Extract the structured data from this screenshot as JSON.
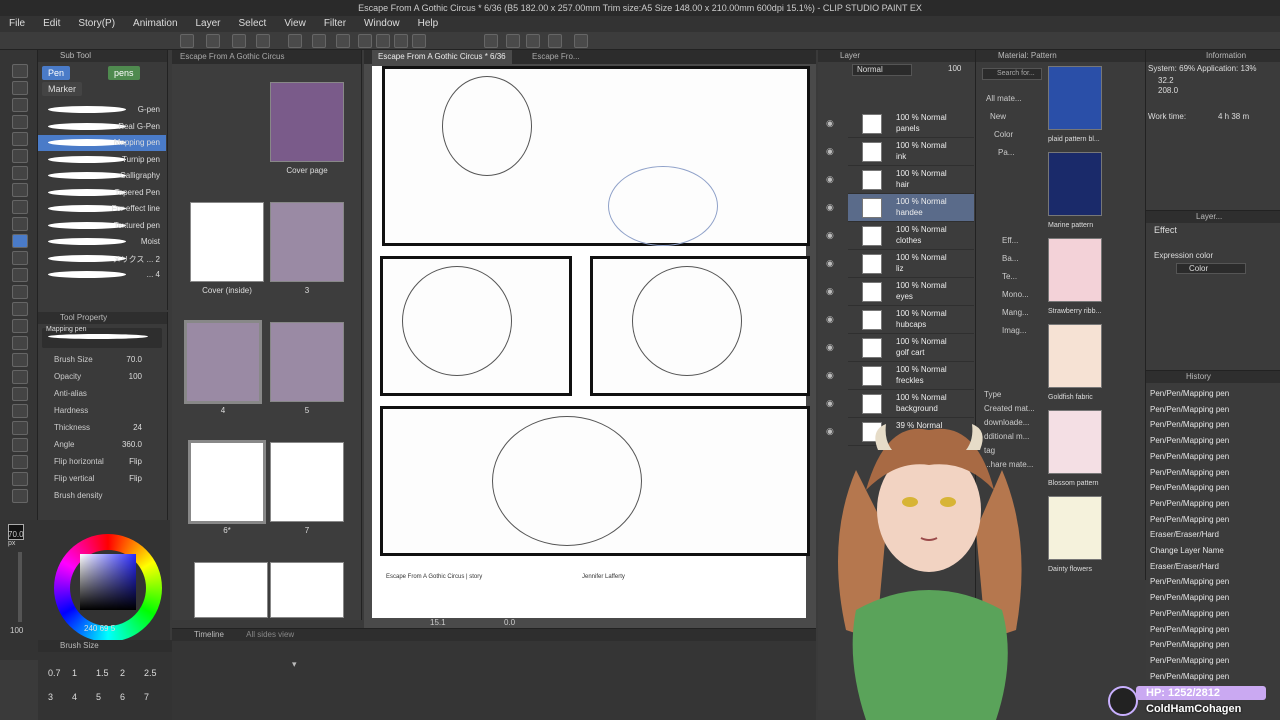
{
  "window": {
    "title": "Escape From A Gothic Circus * 6/36 (B5 182.00 x 257.00mm Trim size:A5 Size 148.00 x 210.00mm 600dpi 15.1%) - CLIP STUDIO PAINT EX"
  },
  "menu": [
    "File",
    "Edit",
    "Story(P)",
    "Animation",
    "Layer",
    "Select",
    "View",
    "Filter",
    "Window",
    "Help"
  ],
  "subtool": {
    "header": "Sub Tool",
    "tab_pen": "Pen",
    "tab_pens": "pens",
    "tab_marker": "Marker",
    "brushes": [
      "G-pen",
      "Real G-Pen",
      "Mapping pen",
      "Turnip pen",
      "Calligraphy",
      "Tapered Pen",
      "For effect line",
      "Textured pen",
      "Moist",
      "メリクス ... 2",
      "... 4"
    ]
  },
  "tool_property": {
    "header": "Tool Property",
    "preview_label": "Mapping pen",
    "rows": [
      {
        "label": "Brush Size",
        "value": "70.0"
      },
      {
        "label": "Opacity",
        "value": "100"
      },
      {
        "label": "Anti-alias",
        "value": ""
      },
      {
        "label": "Hardness",
        "value": ""
      },
      {
        "label": "Thickness",
        "value": "24"
      },
      {
        "label": "Angle",
        "value": "360.0"
      },
      {
        "label": "Flip horizontal",
        "value": "Flip"
      },
      {
        "label": "Flip vertical",
        "value": "Flip"
      },
      {
        "label": "Brush density",
        "value": ""
      }
    ]
  },
  "color": {
    "size_label": "70.0",
    "size_unit": "px",
    "opacity_label": "100",
    "values": "240  69  5"
  },
  "brush_size_panel": {
    "header": "Brush Size",
    "sizes": [
      "0.7",
      "1",
      "1.5",
      "2",
      "2.5",
      "3",
      "4",
      "5",
      "6",
      "7"
    ]
  },
  "pages": {
    "tab": "Escape From A Gothic Circus",
    "items": [
      {
        "label": "Cover page"
      },
      {
        "label": "Cover (inside)"
      },
      {
        "label": "3"
      },
      {
        "label": "4"
      },
      {
        "label": "5"
      },
      {
        "label": "6*"
      },
      {
        "label": "7"
      }
    ]
  },
  "canvas": {
    "tab1": "Escape From A Gothic Circus * 6/36",
    "tab2": "Escape Fro...",
    "footer_left": "Escape From A Gothic Circus  | story",
    "footer_right": "Jennifer Lafferty",
    "zoom": "15.1",
    "angle": "0.0"
  },
  "layers": {
    "header": "Layer",
    "blend": "Normal",
    "opacity": "100",
    "items": [
      {
        "pct": "100 % Normal",
        "name": "panels"
      },
      {
        "pct": "100 % Normal",
        "name": "ink"
      },
      {
        "pct": "100 % Normal",
        "name": "hair"
      },
      {
        "pct": "100 % Normal",
        "name": "handee"
      },
      {
        "pct": "100 % Normal",
        "name": "clothes"
      },
      {
        "pct": "100 % Normal",
        "name": "liz"
      },
      {
        "pct": "100 % Normal",
        "name": "eyes"
      },
      {
        "pct": "100 % Normal",
        "name": "hubcaps"
      },
      {
        "pct": "100 % Normal",
        "name": "golf cart"
      },
      {
        "pct": "100 % Normal",
        "name": "freckles"
      },
      {
        "pct": "100 % Normal",
        "name": "background"
      },
      {
        "pct": "39 % Normal",
        "name": ""
      }
    ]
  },
  "material": {
    "header": "Material: Pattern",
    "search": "Search for...",
    "tree": [
      "All mate...",
      "New",
      "Color",
      "Pa..."
    ],
    "tree2": [
      "Eff...",
      "Ba...",
      "Te...",
      "Mono...",
      "Mang...",
      "Imag..."
    ],
    "type_label": "Type",
    "type_items": [
      "Type",
      "Created mat...",
      "downloade...",
      "dditional m...",
      "tag",
      "...hare mate..."
    ],
    "swatches": [
      {
        "label": "plaid pattern bl...",
        "color": "#2a4fa8"
      },
      {
        "label": "Marine pattern",
        "color": "#1a2a6a"
      },
      {
        "label": "Strawberry ribb...",
        "color": "#f3d2d8"
      },
      {
        "label": "Goldfish fabric",
        "color": "#f6e2d4"
      },
      {
        "label": "Blossom pattern",
        "color": "#f4dfe4"
      },
      {
        "label": "Dainty flowers",
        "color": "#f5f2dc"
      }
    ]
  },
  "info": {
    "header": "Information",
    "system": "System: 69%  Application: 13%",
    "x": "32.2",
    "y": "208.0",
    "work_time_label": "Work time:",
    "work_time": "4 h 38 m"
  },
  "layer_property": {
    "header": "Layer...",
    "effect": "Effect",
    "expression": "Expression color",
    "color_value": "Color"
  },
  "history": {
    "header": "History",
    "items": [
      "Pen/Pen/Mapping pen",
      "Pen/Pen/Mapping pen",
      "Pen/Pen/Mapping pen",
      "Pen/Pen/Mapping pen",
      "Pen/Pen/Mapping pen",
      "Pen/Pen/Mapping pen",
      "Pen/Pen/Mapping pen",
      "Pen/Pen/Mapping pen",
      "Pen/Pen/Mapping pen",
      "Eraser/Eraser/Hard",
      "Change Layer Name",
      "Eraser/Eraser/Hard",
      "Pen/Pen/Mapping pen",
      "Pen/Pen/Mapping pen",
      "Pen/Pen/Mapping pen",
      "Pen/Pen/Mapping pen",
      "Pen/Pen/Mapping pen",
      "Pen/Pen/Mapping pen",
      "Pen/Pen/Mapping pen"
    ]
  },
  "timeline": {
    "header": "Timeline",
    "tab2": "All sides view"
  },
  "stream": {
    "hp": "HP: 1252/2812",
    "name": "ColdHamCohagen"
  },
  "colors": {
    "accent": "#4a7bc8",
    "selected_layer": "#5a6b8a",
    "sweater": "#5aa35a",
    "hair": "#b5774e"
  }
}
